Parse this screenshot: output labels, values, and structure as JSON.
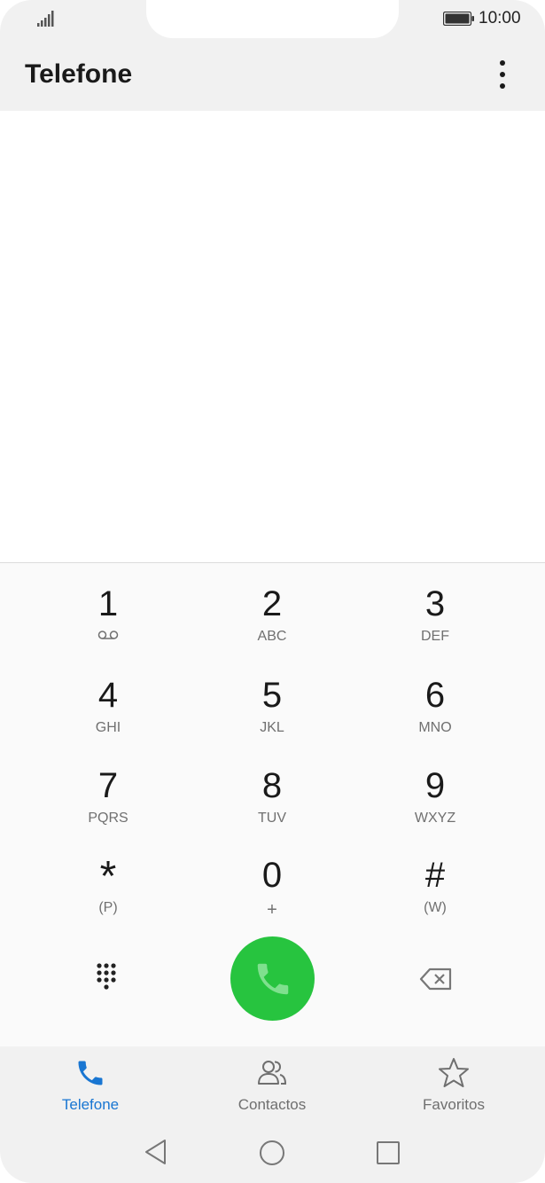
{
  "status_bar": {
    "time": "10:00",
    "signal_icon": "signal-bars-icon",
    "battery_icon": "battery-full-icon"
  },
  "app_bar": {
    "title": "Telefone",
    "menu_icon": "more-vertical-icon"
  },
  "dialpad": {
    "keys": [
      {
        "num": "1",
        "sub": "",
        "sub_icon": "voicemail-icon"
      },
      {
        "num": "2",
        "sub": "ABC"
      },
      {
        "num": "3",
        "sub": "DEF"
      },
      {
        "num": "4",
        "sub": "GHI"
      },
      {
        "num": "5",
        "sub": "JKL"
      },
      {
        "num": "6",
        "sub": "MNO"
      },
      {
        "num": "7",
        "sub": "PQRS"
      },
      {
        "num": "8",
        "sub": "TUV"
      },
      {
        "num": "9",
        "sub": "WXYZ"
      },
      {
        "num": "*",
        "sub": "(P)"
      },
      {
        "num": "0",
        "sub": "+"
      },
      {
        "num": "#",
        "sub": "(W)"
      }
    ],
    "call_button_icon": "phone-icon",
    "call_button_color": "#27c43f",
    "toggle_icon": "dialpad-grid-icon",
    "backspace_icon": "backspace-icon"
  },
  "tabs": [
    {
      "label": "Telefone",
      "icon": "phone-icon",
      "active": true
    },
    {
      "label": "Contactos",
      "icon": "contacts-icon",
      "active": false
    },
    {
      "label": "Favoritos",
      "icon": "star-icon",
      "active": false
    }
  ],
  "colors": {
    "accent": "#1976d2",
    "call_green": "#27c43f"
  },
  "system_nav": [
    "back-icon",
    "home-icon",
    "recents-icon"
  ]
}
